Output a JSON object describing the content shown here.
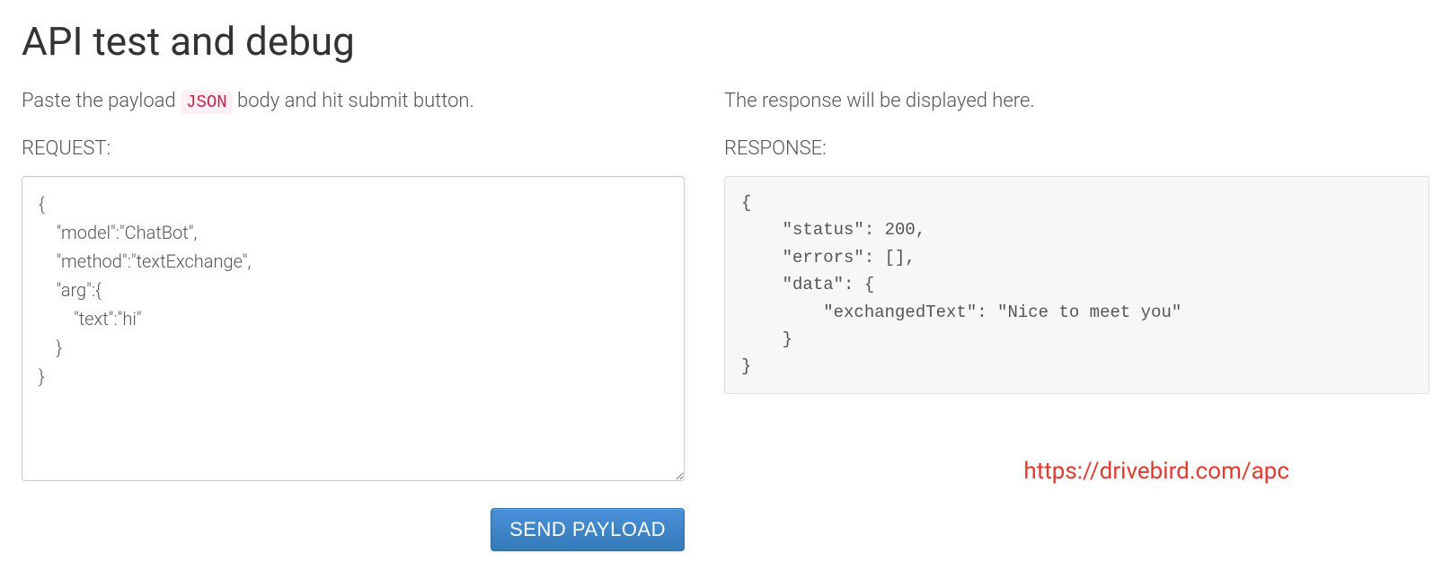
{
  "header": {
    "title": "API test and debug"
  },
  "request": {
    "lead_before": "Paste the payload ",
    "lead_code": "JSON",
    "lead_after": " body and hit submit button.",
    "section_label": "REQUEST:",
    "payload_value": "{\n    \"model\":\"ChatBot\",\n    \"method\":\"textExchange\",\n    \"arg\":{\n        \"text\":\"hi\"\n    }\n}",
    "send_button_label": "SEND PAYLOAD"
  },
  "response": {
    "lead_text": "The response will be displayed here.",
    "section_label": "RESPONSE:",
    "body": "{\n    \"status\": 200,\n    \"errors\": [],\n    \"data\": {\n        \"exchangedText\": \"Nice to meet you\"\n    }\n}"
  },
  "overlay": {
    "link_text": "https://drivebird.com/apc"
  }
}
